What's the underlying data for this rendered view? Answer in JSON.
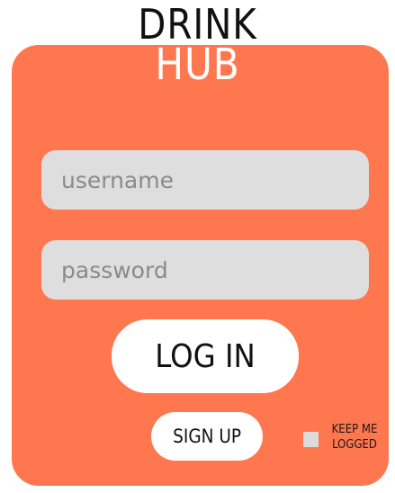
{
  "logo": {
    "top": "DRINK",
    "bottom": "HUB"
  },
  "form": {
    "username_placeholder": "username",
    "password_placeholder": "password",
    "login_label": "LOG IN",
    "signup_label": "SIGN UP",
    "keep_logged_label": "KEEP ME\nLOGGED",
    "keep_logged_checked": false
  },
  "colors": {
    "card": "#ff774e",
    "field": "#dedede",
    "logo_top": "#111111",
    "logo_bottom": "#ffffff"
  }
}
